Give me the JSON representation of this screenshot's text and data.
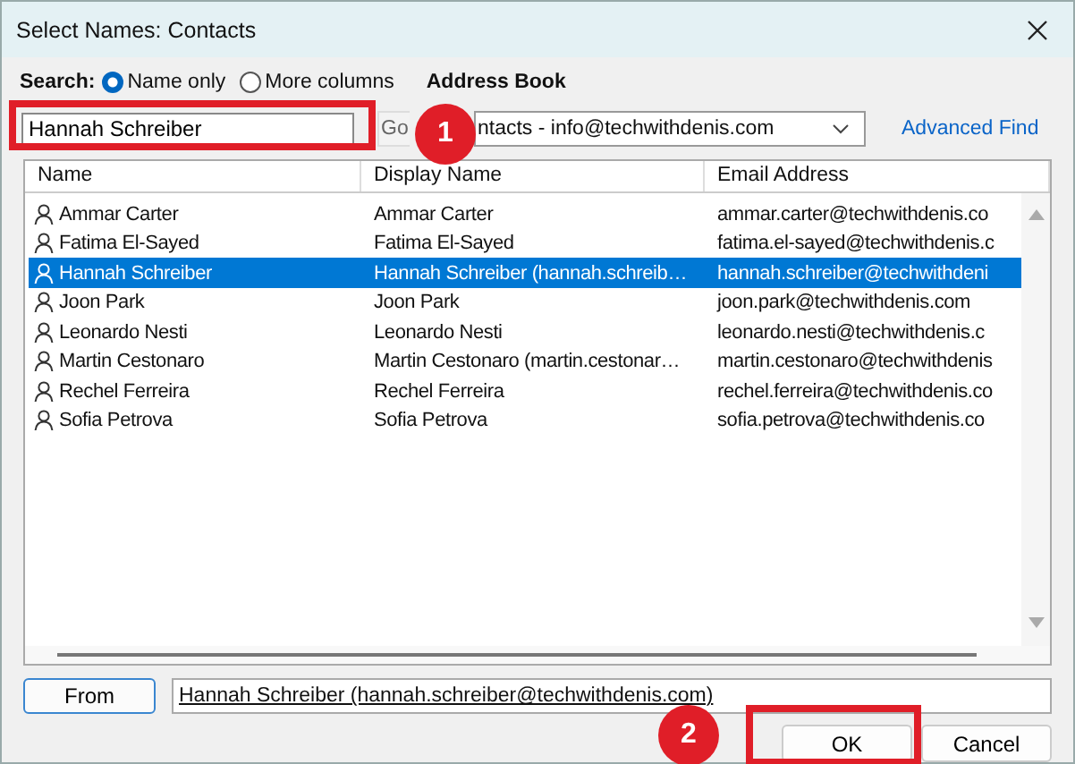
{
  "window": {
    "title": "Select Names: Contacts"
  },
  "search": {
    "label": "Search:",
    "options": [
      {
        "label": "Name only",
        "selected": true
      },
      {
        "label": "More columns",
        "selected": false
      }
    ],
    "value": "Hannah Schreiber",
    "go": "Go"
  },
  "address_book": {
    "label": "Address Book",
    "value": "ntacts - info@techwithdenis.com"
  },
  "advanced_find": "Advanced Find",
  "table": {
    "columns": [
      "Name",
      "Display Name",
      "Email Address"
    ],
    "rows": [
      {
        "name": "Ammar Carter",
        "display": "Ammar Carter",
        "email": "ammar.carter@techwithdenis.co",
        "selected": false
      },
      {
        "name": "Fatima El-Sayed",
        "display": "Fatima El-Sayed",
        "email": "fatima.el-sayed@techwithdenis.c",
        "selected": false
      },
      {
        "name": "Hannah Schreiber",
        "display": "Hannah Schreiber (hannah.schreib…",
        "email": "hannah.schreiber@techwithdeni",
        "selected": true
      },
      {
        "name": "Joon Park",
        "display": "Joon Park",
        "email": "joon.park@techwithdenis.com",
        "selected": false
      },
      {
        "name": "Leonardo Nesti",
        "display": "Leonardo Nesti",
        "email": "leonardo.nesti@techwithdenis.c",
        "selected": false
      },
      {
        "name": "Martin Cestonaro",
        "display": "Martin Cestonaro (martin.cestonar…",
        "email": "martin.cestonaro@techwithdenis",
        "selected": false
      },
      {
        "name": "Rechel Ferreira",
        "display": "Rechel Ferreira",
        "email": "rechel.ferreira@techwithdenis.co",
        "selected": false
      },
      {
        "name": "Sofia Petrova",
        "display": "Sofia Petrova",
        "email": "sofia.petrova@techwithdenis.co",
        "selected": false
      }
    ]
  },
  "from": {
    "button": "From",
    "value": "Hannah Schreiber (hannah.schreiber@techwithdenis.com)"
  },
  "buttons": [
    "OK",
    "Cancel"
  ],
  "annotations": [
    {
      "label": "1"
    },
    {
      "label": "2"
    }
  ]
}
